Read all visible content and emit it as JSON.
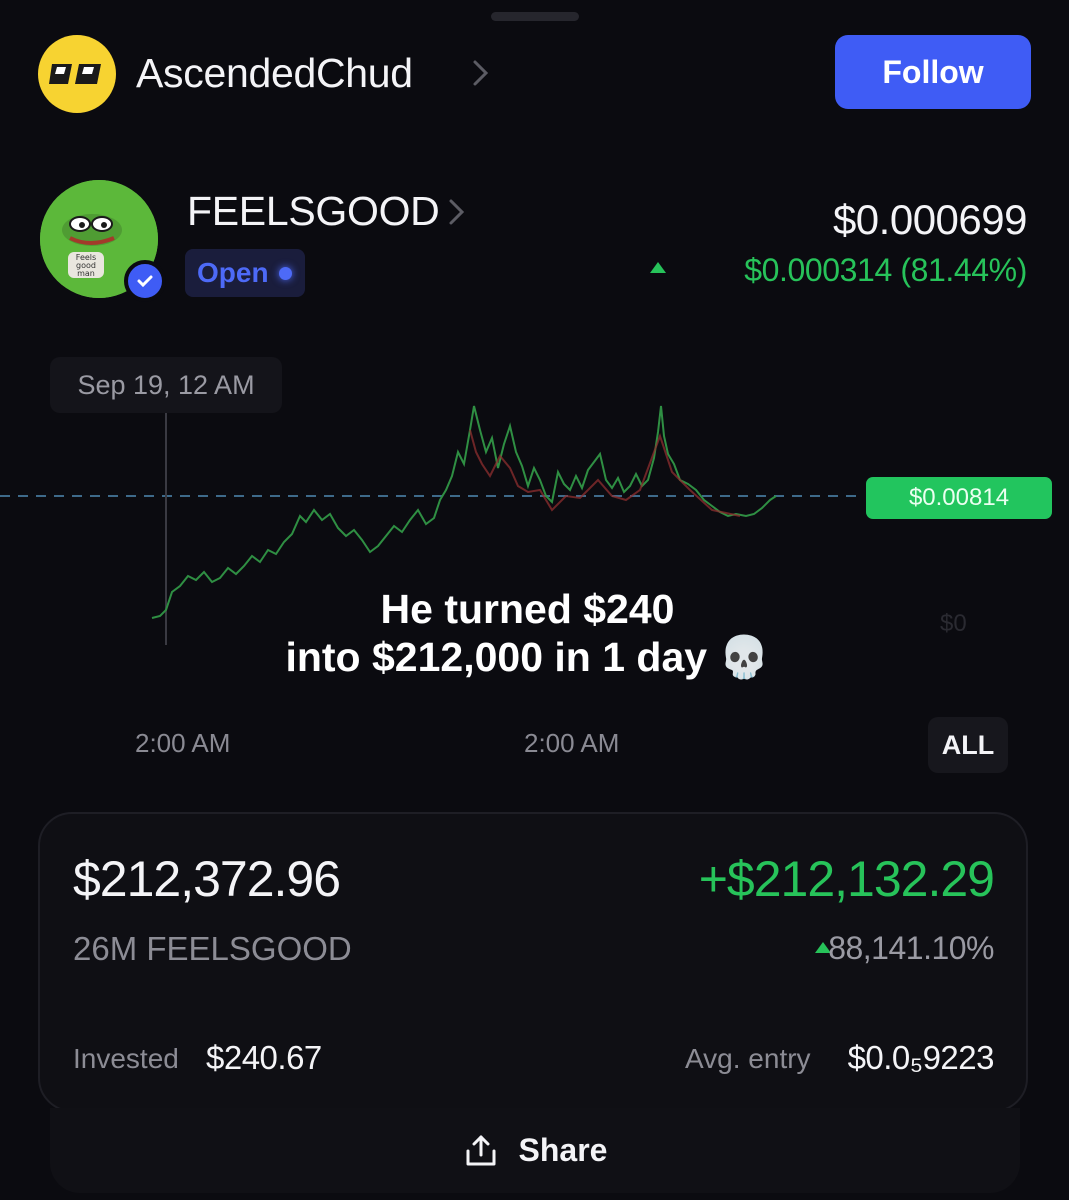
{
  "header": {
    "username": "AscendedChud",
    "follow_label": "Follow"
  },
  "token": {
    "name": "FEELSGOOD",
    "status": "Open",
    "avatar_text": "Feels good man",
    "price": "$0.000699",
    "change": "$0.000314 (81.44%)"
  },
  "chart": {
    "date_tooltip": "Sep 19, 12 AM",
    "price_tag": "$0.00814",
    "zero_label": "$0",
    "time_labels": [
      "2:00 AM",
      "2:00 AM"
    ],
    "range_button": "ALL",
    "caption_line1": "He turned $240",
    "caption_line2": "into $212,000 in 1 day 💀"
  },
  "position": {
    "value": "$212,372.96",
    "profit": "+$212,132.29",
    "amount": "26M FEELSGOOD",
    "percent": "88,141.10%",
    "invested_label": "Invested",
    "invested_value": "$240.67",
    "avg_entry_label": "Avg. entry",
    "avg_entry_value": "$0.0₅9223"
  },
  "footer": {
    "share_label": "Share"
  },
  "colors": {
    "accent": "#3f5cf5",
    "positive": "#27c35a",
    "background": "#0b0b10"
  },
  "icons": [
    "avatar-icon",
    "chevron-right-icon",
    "verified-icon",
    "share-icon",
    "up-arrow-icon"
  ]
}
